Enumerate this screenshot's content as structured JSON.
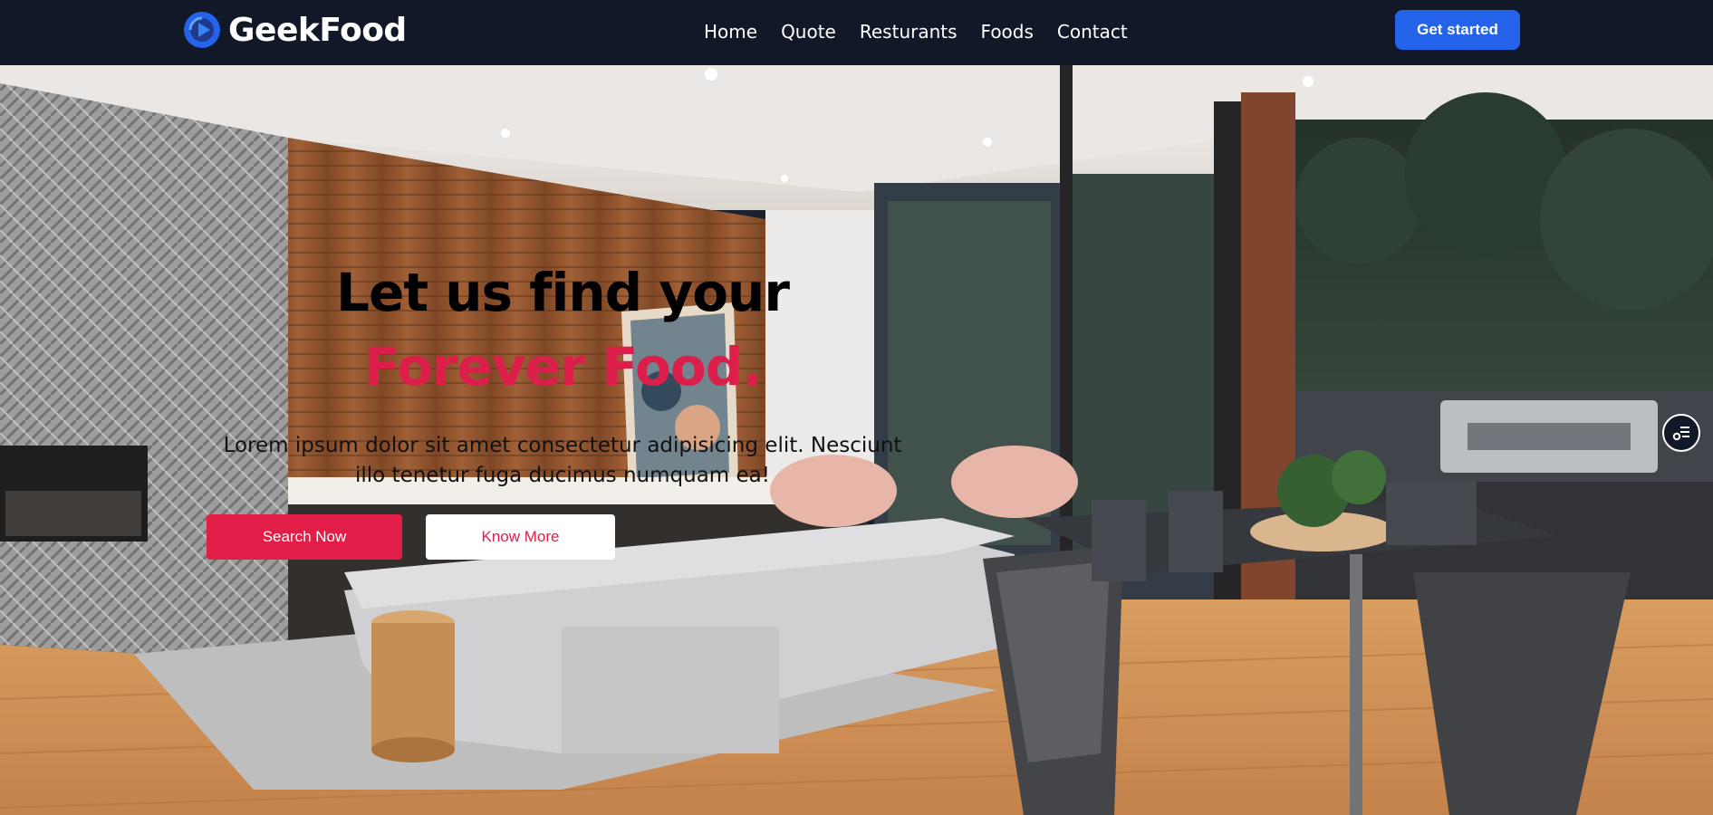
{
  "brand": {
    "name": "GeekFood",
    "logo_icon": "play-circle-icon",
    "accent_color": "#2563eb"
  },
  "nav": {
    "items": [
      {
        "label": "Home"
      },
      {
        "label": "Quote"
      },
      {
        "label": "Resturants"
      },
      {
        "label": "Foods"
      },
      {
        "label": "Contact"
      }
    ],
    "cta_label": "Get started"
  },
  "hero": {
    "headline_line1": "Let us find your",
    "headline_line2": "Forever Food.",
    "description": "Lorem ipsum dolor sit amet consectetur adipisicing elit. Nesciunt illo tenetur fuga ducimus numquam ea!",
    "primary_button": "Search Now",
    "secondary_button": "Know More",
    "highlight_color": "#e11d48"
  },
  "floating_widget": {
    "icon": "settings-list-icon"
  }
}
